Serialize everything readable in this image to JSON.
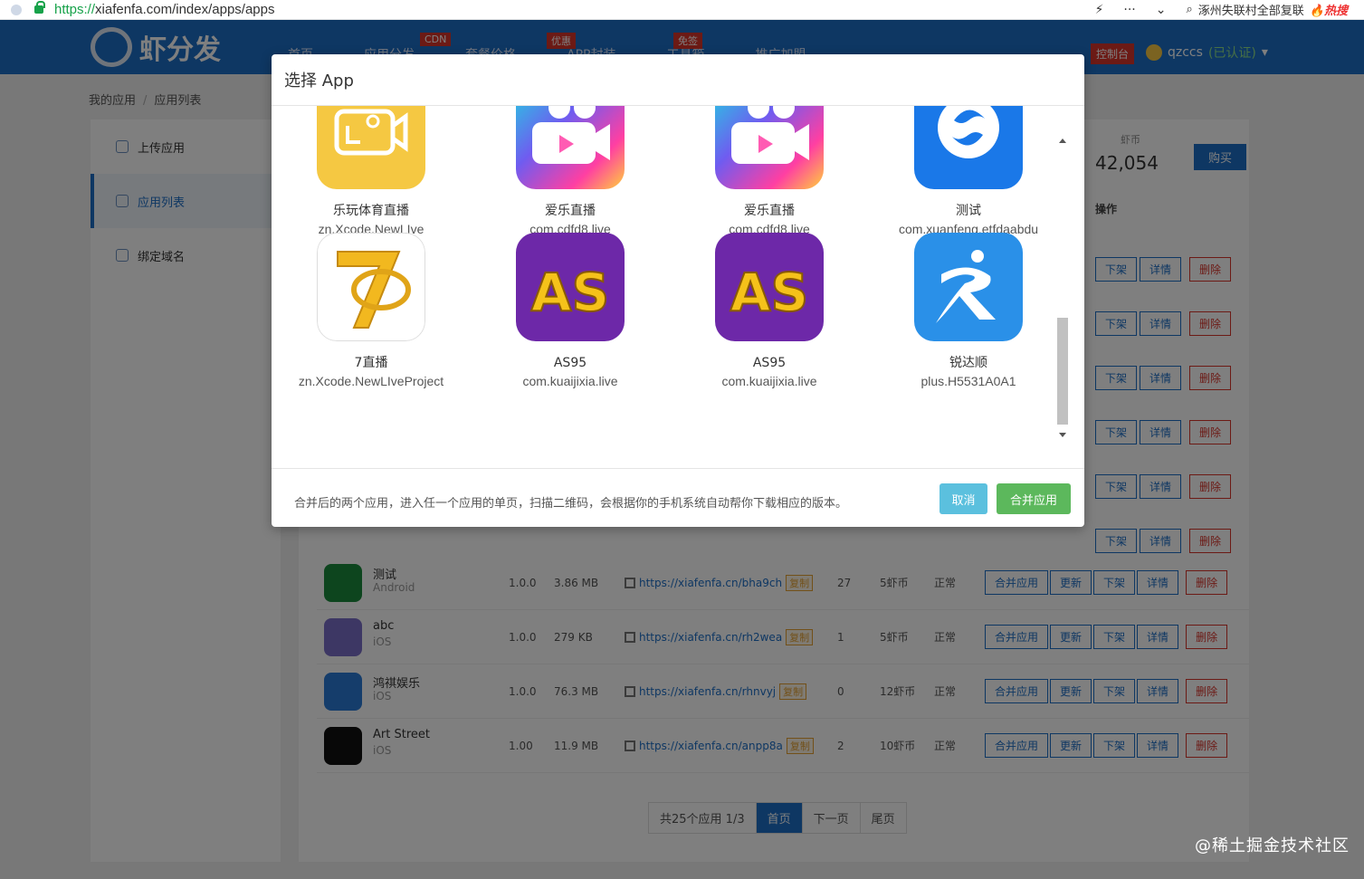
{
  "browser": {
    "url_scheme": "https://",
    "url_rest": "xiafenfa.com/index/apps/apps",
    "search_text": "涿州失联村全部复联",
    "hot_label": "热搜",
    "more_icon": "···",
    "down_icon": "⌄"
  },
  "site": {
    "logo_text": "虾分发",
    "nav": [
      "首页",
      "应用分发",
      "套餐价格",
      "APP封装",
      "工具箱",
      "推广加盟"
    ],
    "badges": {
      "cdn": "CDN",
      "youhui": "优惠",
      "mianqian": "免签"
    },
    "console_label": "控制台",
    "username": "qzccs",
    "cert": "(已认证)",
    "crumbs": [
      "我的应用",
      "应用列表"
    ],
    "sidebar": [
      "上传应用",
      "应用列表",
      "绑定域名"
    ],
    "coins_label": "虾币",
    "coins_value": "42,054",
    "buy_label": "购买",
    "ops_header": "操作"
  },
  "rows": [
    {
      "name": "测试",
      "os": "Android",
      "version": "1.0.0",
      "size": "3.86 MB",
      "link": "https://xiafenfa.cn/bha9ch",
      "dl": "27",
      "price": "5虾币",
      "status": "正常",
      "color": "#1a8a3c"
    },
    {
      "name": "abc",
      "os": "iOS",
      "version": "1.0.0",
      "size": "279 KB",
      "link": "https://xiafenfa.cn/rh2wea",
      "dl": "1",
      "price": "5虾币",
      "status": "正常",
      "color": "#7b6fc9"
    },
    {
      "name": "鸿祺娱乐",
      "os": "iOS",
      "version": "1.0.0",
      "size": "76.3 MB",
      "link": "https://xiafenfa.cn/rhnvyj",
      "dl": "0",
      "price": "12虾币",
      "status": "正常",
      "color": "#2a7bd6"
    },
    {
      "name": "Art Street",
      "os": "iOS",
      "version": "1.00",
      "size": "11.9 MB",
      "link": "https://xiafenfa.cn/anpp8a",
      "dl": "2",
      "price": "10虾币",
      "status": "正常",
      "color": "#111111"
    }
  ],
  "row_buttons": {
    "merge": "合并应用",
    "update": "更新",
    "down": "下架",
    "detail": "详情",
    "delete": "删除",
    "copy": "复制"
  },
  "pager": {
    "info": "共25个应用 1/3",
    "first": "首页",
    "next": "下一页",
    "last": "尾页"
  },
  "watermark": "@稀土掘金技术社区",
  "modal": {
    "title": "选择 App",
    "apps": [
      {
        "name": "乐玩体育直播",
        "bundle": "zn.Xcode.NewLIve",
        "icon": "tv-camera-icon"
      },
      {
        "name": "爱乐直播",
        "bundle": "com.cdfd8.live",
        "icon": "video-camera-icon"
      },
      {
        "name": "爱乐直播",
        "bundle": "com.cdfd8.live",
        "icon": "video-camera-icon"
      },
      {
        "name": "测试",
        "bundle": "com.xuanfeng.etfdaabdu",
        "icon": "swirl-icon"
      },
      {
        "name": "7直播",
        "bundle": "zn.Xcode.NewLIveProject",
        "icon": "seven-film-icon"
      },
      {
        "name": "AS95",
        "bundle": "com.kuaijixia.live",
        "icon": "as-logo-icon"
      },
      {
        "name": "AS95",
        "bundle": "com.kuaijixia.live",
        "icon": "as-logo-icon"
      },
      {
        "name": "锐达顺",
        "bundle": "plus.H5531A0A1",
        "icon": "r-logo-icon"
      }
    ],
    "footer_text": "合并后的两个应用，进入任一个应用的单页，扫描二维码，会根据你的手机系统自动帮你下载相应的版本。",
    "cancel_label": "取消",
    "merge_label": "合并应用",
    "colors": {
      "cancel": "#5bc0de",
      "merge": "#5cb85c",
      "primary": "#1d6ec6"
    }
  }
}
